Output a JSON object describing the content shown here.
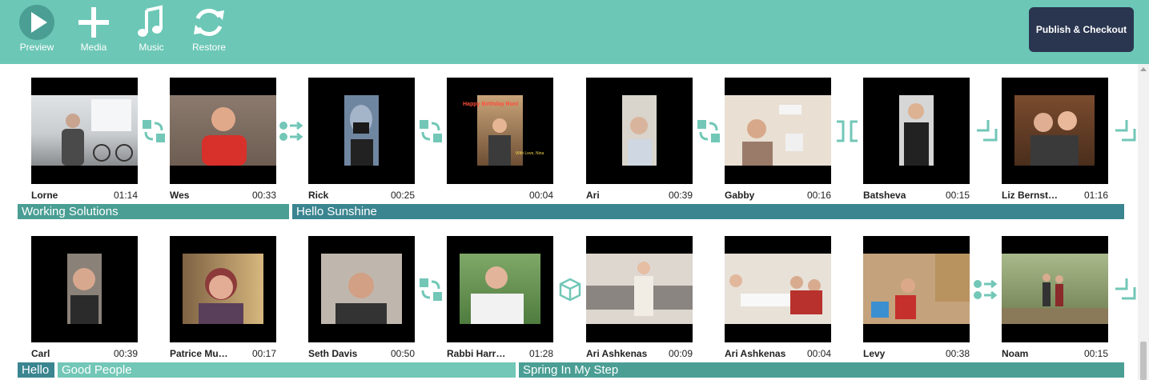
{
  "toolbar": {
    "preview": "Preview",
    "media": "Media",
    "music": "Music",
    "restore": "Restore",
    "publish": "Publish & Checkout"
  },
  "colors": {
    "toolbar_bg": "#6cc7b6",
    "accent_teal": "#4a9e94",
    "song_dark": "#3a8590",
    "song_light": "#72c7b7",
    "publish_bg": "#2a3650"
  },
  "row1": {
    "clips": [
      {
        "name": "Lorne",
        "duration": "01:14"
      },
      {
        "name": "Wes",
        "duration": "00:33"
      },
      {
        "name": "Rick",
        "duration": "00:25"
      },
      {
        "name": "",
        "duration": "00:04",
        "overlay_top": "Happy Birthday Ron!",
        "overlay_bottom": "With Love, Nina"
      },
      {
        "name": "Ari",
        "duration": "00:39"
      },
      {
        "name": "Gabby",
        "duration": "00:16"
      },
      {
        "name": "Batsheva",
        "duration": "00:15"
      },
      {
        "name": "Liz Bernst…",
        "duration": "01:16"
      }
    ],
    "songs": [
      {
        "title": "Working Solutions"
      },
      {
        "title": "Hello Sunshine"
      }
    ],
    "transitions": [
      "swap-icon",
      "dots-arrows-icon",
      "swap-icon",
      "swap-icon",
      "split-brackets-icon",
      "corner-arrow-icon",
      "corner-arrow-icon"
    ]
  },
  "row2": {
    "clips": [
      {
        "name": "Carl",
        "duration": "00:39"
      },
      {
        "name": "Patrice Mu…",
        "duration": "00:17"
      },
      {
        "name": "Seth Davis",
        "duration": "00:50"
      },
      {
        "name": "Rabbi Harr…",
        "duration": "01:28"
      },
      {
        "name": "Ari Ashkenas",
        "duration": "00:09"
      },
      {
        "name": "Ari Ashkenas",
        "duration": "00:04"
      },
      {
        "name": "Levy",
        "duration": "00:38"
      },
      {
        "name": "Noam",
        "duration": "00:15"
      }
    ],
    "songs": [
      {
        "title": "Hello"
      },
      {
        "title": "Good People"
      },
      {
        "title": "Spring In My Step"
      }
    ],
    "transitions": [
      "swap-icon",
      "cube-icon",
      "dots-arrows-icon",
      "corner-arrow-icon"
    ]
  }
}
